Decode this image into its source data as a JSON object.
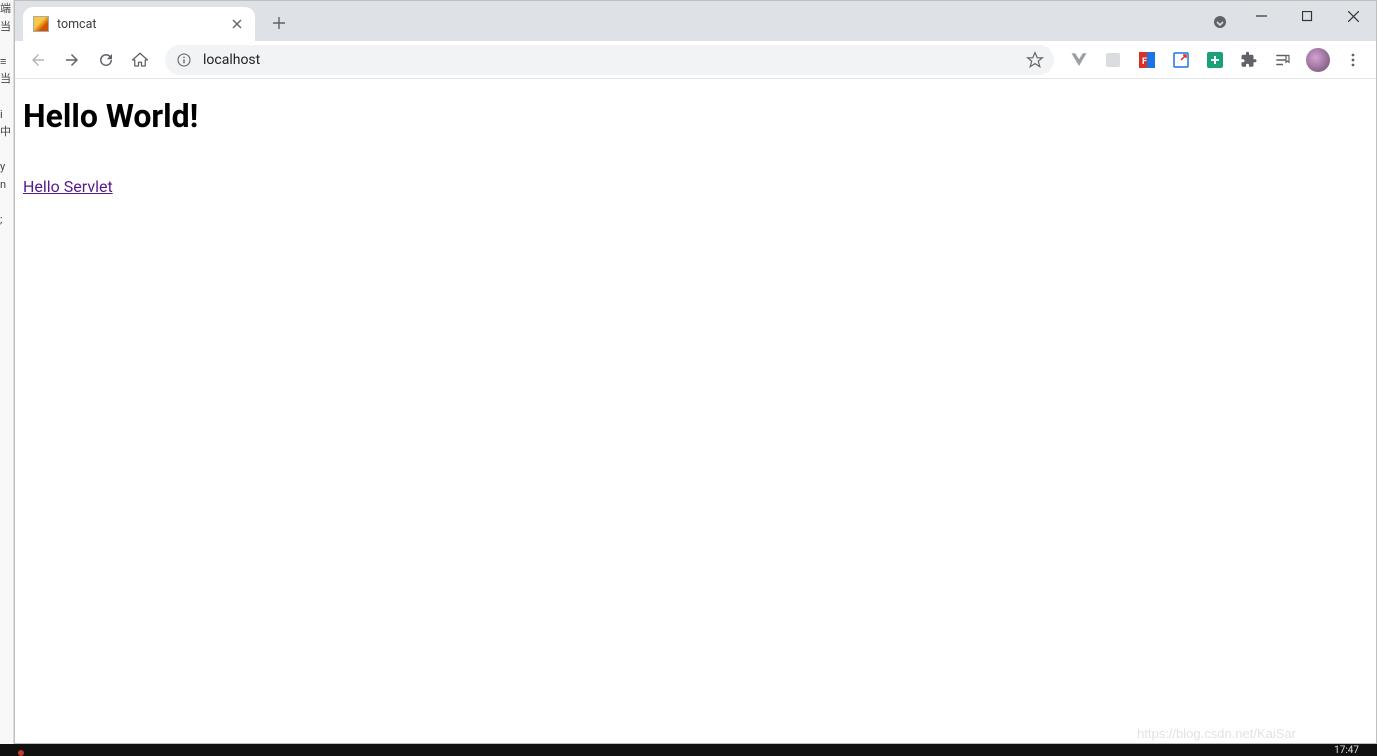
{
  "window": {
    "tab": {
      "title": "tomcat"
    }
  },
  "toolbar": {
    "url": "localhost"
  },
  "page": {
    "heading": "Hello World!",
    "link_text": "Hello Servlet"
  },
  "watermark": "https://blog.csdn.net/KaiSar",
  "taskbar": {
    "clock": "17:47"
  }
}
